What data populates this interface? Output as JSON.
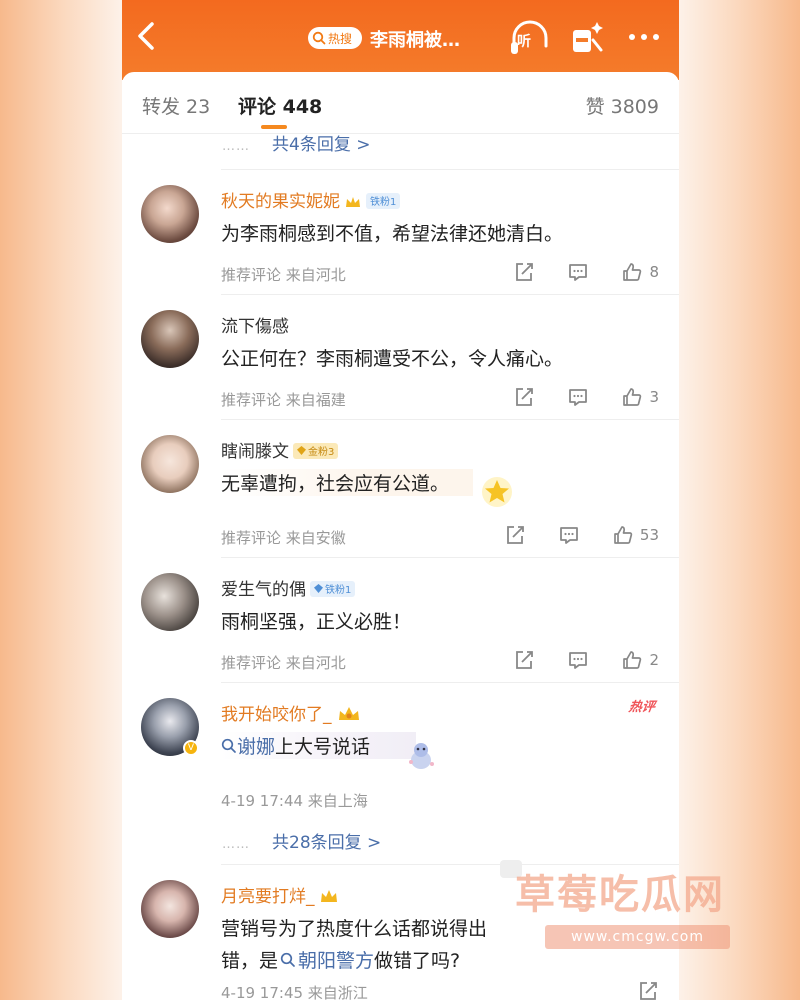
{
  "header": {
    "hot_badge": "热搜",
    "topic_title": "李雨桐被…",
    "listen_label": "听"
  },
  "tabs": {
    "repost": "转发 23",
    "comments": "评论 448",
    "likes": "赞 3809"
  },
  "top_replies_link": "共4条回复 >",
  "comments": [
    {
      "username": "秋天的果实妮妮",
      "fan_badge": "铁粉1",
      "text": "为李雨桐感到不值，希望法律还她清白。",
      "meta": "推荐评论  来自河北",
      "likes": "8"
    },
    {
      "username": "流下傷感",
      "text": "公正何在？李雨桐遭受不公，令人痛心。",
      "meta": "推荐评论  来自福建",
      "likes": "3"
    },
    {
      "username": "瞎闹滕文",
      "fan_badge": "金粉3",
      "text": "无辜遭拘，社会应有公道。",
      "meta": "推荐评论  来自安徽",
      "likes": "53"
    },
    {
      "username": "爱生气的偶",
      "fan_badge": "铁粉1",
      "text": "雨桐坚强，正义必胜！",
      "meta": "推荐评论  来自河北",
      "likes": "2"
    },
    {
      "username": "我开始咬你了_",
      "hot_label": "热评",
      "text_link": "谢娜",
      "text_rest": "上大号说话",
      "meta": "4-19 17:44  来自上海",
      "replies_link": "共28条回复 >"
    },
    {
      "username": "月亮要打烊_",
      "text_line1": "营销号为了热度什么话都说得出",
      "text_line2_a": "错，是",
      "text_link": "朝阳警方",
      "text_line2_b": "做错了吗?",
      "meta": "4-19 17:45  来自浙江"
    }
  ],
  "watermark": {
    "title": "草莓吃瓜网",
    "url": "www.cmcgw.com"
  },
  "colors": {
    "header_orange": "#f36a1f",
    "link_blue": "#4a6ea9",
    "username_orange": "#e27b22",
    "tab_underline": "#f5891f"
  }
}
